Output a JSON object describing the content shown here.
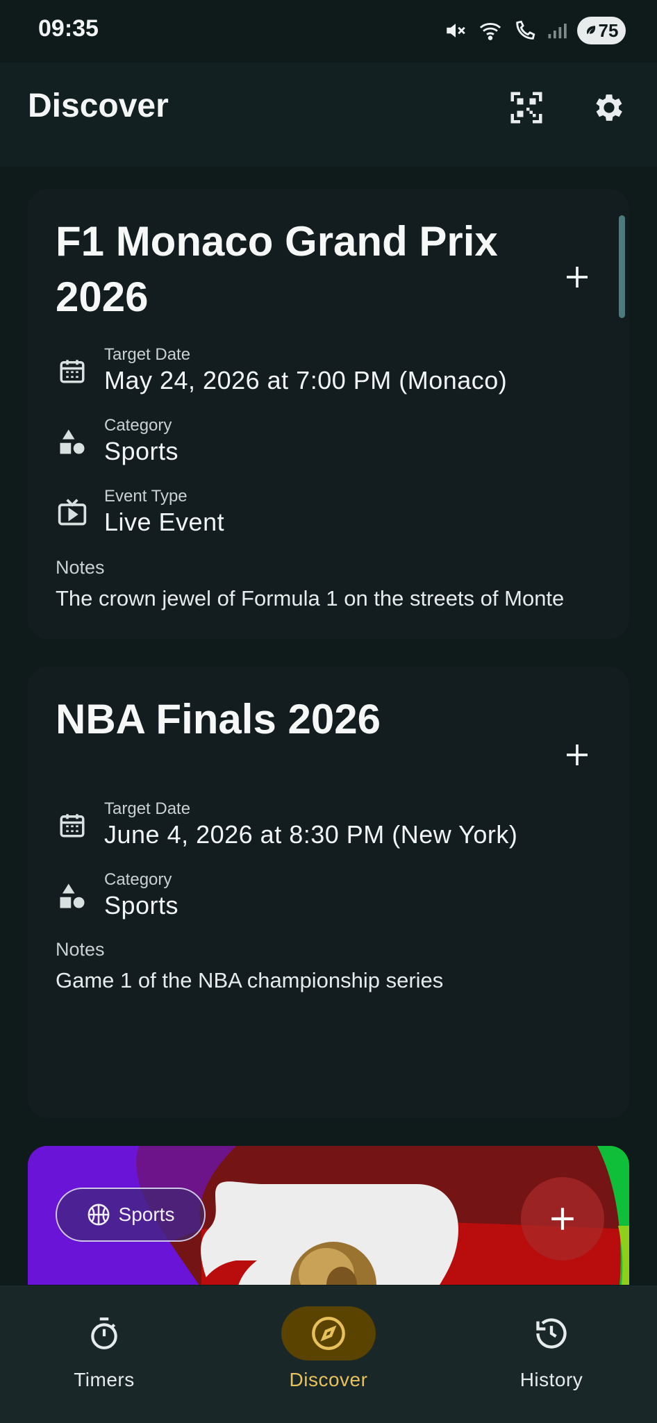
{
  "status": {
    "time": "09:35",
    "battery": "75"
  },
  "header": {
    "title": "Discover"
  },
  "cards": [
    {
      "title": "F1 Monaco Grand Prix 2026",
      "target_date_label": "Target Date",
      "target_date": "May 24, 2026 at 7:00 PM (Monaco)",
      "category_label": "Category",
      "category": "Sports",
      "event_type_label": "Event Type",
      "event_type": "Live Event",
      "notes_label": "Notes",
      "notes": "The crown jewel of Formula 1 on the streets of Monte"
    },
    {
      "title": "NBA Finals 2026",
      "target_date_label": "Target Date",
      "target_date": "June 4, 2026 at 8:30 PM (New York)",
      "category_label": "Category",
      "category": "Sports",
      "notes_label": "Notes",
      "notes": "Game 1 of the NBA championship series"
    }
  ],
  "promo": {
    "tag": "Sports"
  },
  "nav": [
    {
      "label": "Timers",
      "icon": "stopwatch-icon"
    },
    {
      "label": "Discover",
      "icon": "compass-icon"
    },
    {
      "label": "History",
      "icon": "history-icon"
    }
  ],
  "colors": {
    "accent": "#e8c15a",
    "active_pill": "#5a4300",
    "background": "#0f1a1b",
    "card": "#131d1f"
  }
}
